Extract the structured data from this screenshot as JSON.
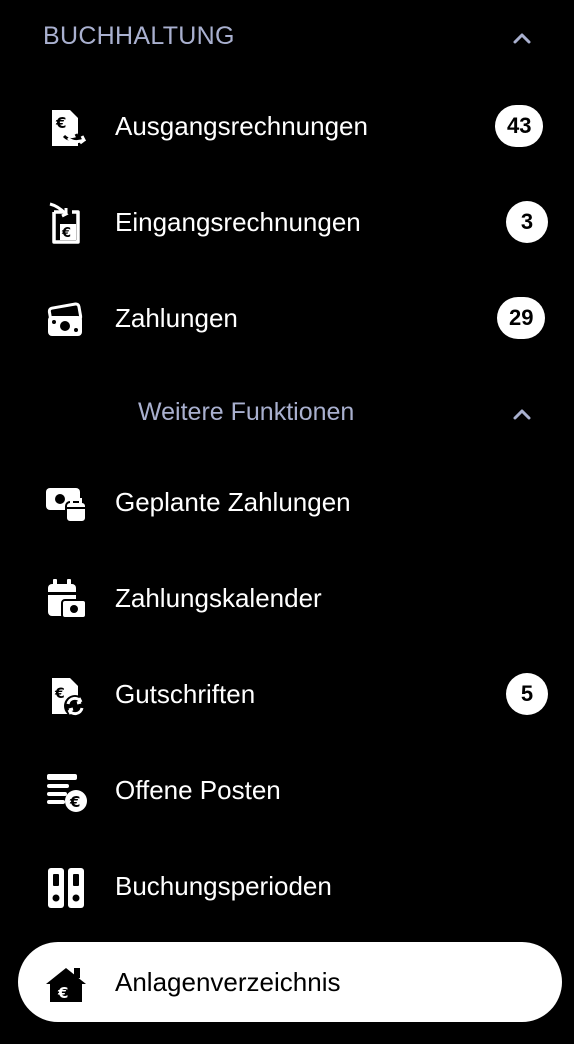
{
  "section": {
    "title": "BUCHHALTUNG",
    "collapse_icon": "chevron-up-icon"
  },
  "items_top": [
    {
      "label": "Ausgangsrechnungen",
      "badge": "43",
      "icon": "outgoing-invoice-icon"
    },
    {
      "label": "Eingangsrechnungen",
      "badge": "3",
      "icon": "incoming-invoice-icon"
    },
    {
      "label": "Zahlungen",
      "badge": "29",
      "icon": "payments-icon"
    }
  ],
  "subsection": {
    "title": "Weitere Funktionen",
    "collapse_icon": "chevron-up-icon"
  },
  "items_more": [
    {
      "label": "Geplante Zahlungen",
      "icon": "scheduled-payments-icon"
    },
    {
      "label": "Zahlungskalender",
      "icon": "payment-calendar-icon"
    },
    {
      "label": "Gutschriften",
      "badge": "5",
      "icon": "credit-note-icon"
    },
    {
      "label": "Offene Posten",
      "icon": "open-items-icon"
    },
    {
      "label": "Buchungsperioden",
      "icon": "booking-periods-icon"
    },
    {
      "label": "Anlagenverzeichnis",
      "icon": "asset-register-icon",
      "active": true
    }
  ],
  "colors": {
    "background": "#000000",
    "section_text": "#a9b0cf",
    "active_bg": "#ffffff",
    "badge_bg": "#ffffff"
  }
}
